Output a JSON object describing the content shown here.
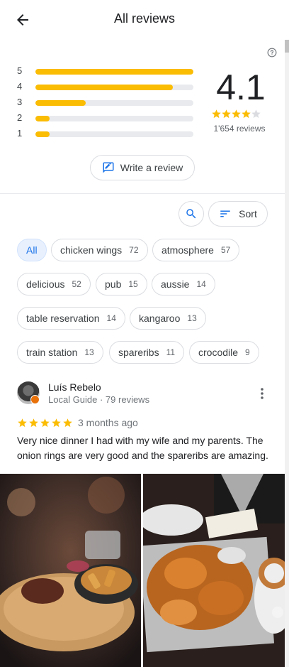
{
  "header": {
    "title": "All reviews"
  },
  "summary": {
    "average": "4.1",
    "average_stars": 4,
    "total_reviews": "1'654 reviews",
    "distribution": [
      {
        "stars": "5",
        "fraction": 1.0
      },
      {
        "stars": "4",
        "fraction": 0.87
      },
      {
        "stars": "3",
        "fraction": 0.32
      },
      {
        "stars": "2",
        "fraction": 0.09
      },
      {
        "stars": "1",
        "fraction": 0.09
      }
    ]
  },
  "actions": {
    "write_review": "Write a review",
    "sort": "Sort"
  },
  "topics": [
    {
      "label": "All",
      "count": ""
    },
    {
      "label": "chicken wings",
      "count": "72"
    },
    {
      "label": "atmosphere",
      "count": "57"
    },
    {
      "label": "delicious",
      "count": "52"
    },
    {
      "label": "pub",
      "count": "15"
    },
    {
      "label": "aussie",
      "count": "14"
    },
    {
      "label": "table reservation",
      "count": "14"
    },
    {
      "label": "kangaroo",
      "count": "13"
    },
    {
      "label": "train station",
      "count": "13"
    },
    {
      "label": "spareribs",
      "count": "11"
    },
    {
      "label": "crocodile",
      "count": "9"
    }
  ],
  "review": {
    "author": "Luís Rebelo",
    "meta": "Local Guide · 79 reviews",
    "rating": 5,
    "time": "3 months ago",
    "text": "Very nice dinner I had with my wife and my parents. The onion rings are very good and the spareribs are amazing."
  },
  "colors": {
    "star": "#fbbc04",
    "accent": "#1a73e8",
    "badge": "#e8710a"
  }
}
